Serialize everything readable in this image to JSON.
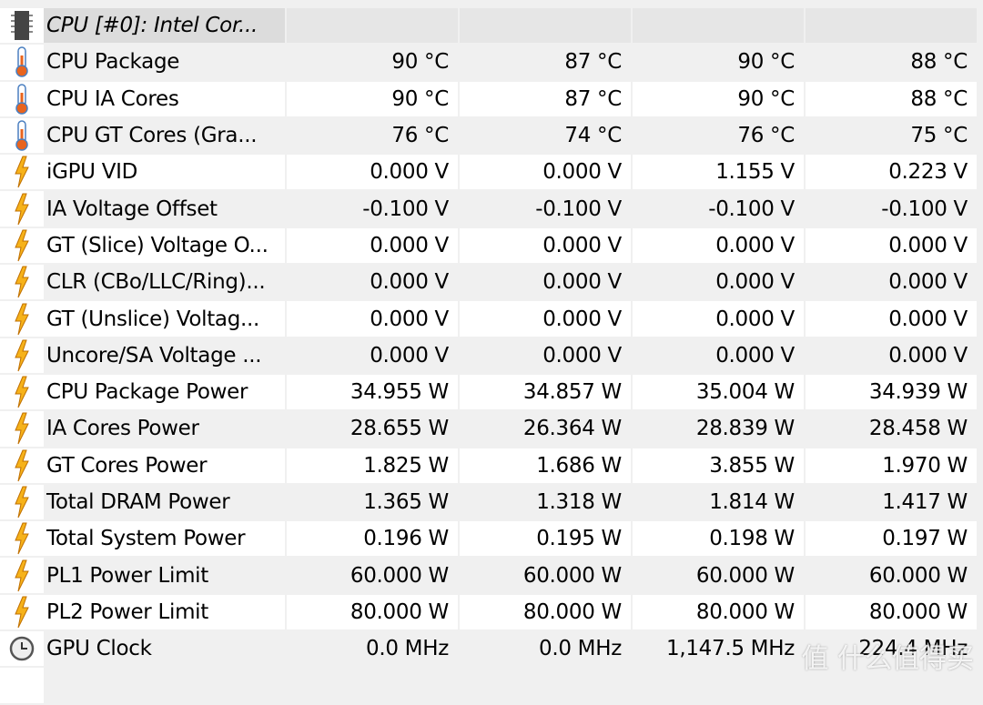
{
  "header": {
    "icon": "chip-icon",
    "label": "CPU [#0]: Intel Cor..."
  },
  "rows": [
    {
      "icon": "thermometer",
      "label": "CPU Package",
      "values": [
        "90 °C",
        "87 °C",
        "90 °C",
        "88 °C"
      ]
    },
    {
      "icon": "thermometer",
      "label": "CPU IA Cores",
      "values": [
        "90 °C",
        "87 °C",
        "90 °C",
        "88 °C"
      ]
    },
    {
      "icon": "thermometer",
      "label": "CPU GT Cores (Gra...",
      "values": [
        "76 °C",
        "74 °C",
        "76 °C",
        "75 °C"
      ]
    },
    {
      "icon": "lightning",
      "label": "iGPU VID",
      "values": [
        "0.000 V",
        "0.000 V",
        "1.155 V",
        "0.223 V"
      ]
    },
    {
      "icon": "lightning",
      "label": "IA Voltage Offset",
      "values": [
        "-0.100 V",
        "-0.100 V",
        "-0.100 V",
        "-0.100 V"
      ]
    },
    {
      "icon": "lightning",
      "label": "GT (Slice) Voltage O...",
      "values": [
        "0.000 V",
        "0.000 V",
        "0.000 V",
        "0.000 V"
      ]
    },
    {
      "icon": "lightning",
      "label": "CLR (CBo/LLC/Ring)...",
      "values": [
        "0.000 V",
        "0.000 V",
        "0.000 V",
        "0.000 V"
      ]
    },
    {
      "icon": "lightning",
      "label": "GT (Unslice) Voltag...",
      "values": [
        "0.000 V",
        "0.000 V",
        "0.000 V",
        "0.000 V"
      ]
    },
    {
      "icon": "lightning",
      "label": "Uncore/SA Voltage ...",
      "values": [
        "0.000 V",
        "0.000 V",
        "0.000 V",
        "0.000 V"
      ]
    },
    {
      "icon": "lightning",
      "label": "CPU Package Power",
      "values": [
        "34.955 W",
        "34.857 W",
        "35.004 W",
        "34.939 W"
      ]
    },
    {
      "icon": "lightning",
      "label": "IA Cores Power",
      "values": [
        "28.655 W",
        "26.364 W",
        "28.839 W",
        "28.458 W"
      ]
    },
    {
      "icon": "lightning",
      "label": "GT Cores Power",
      "values": [
        "1.825 W",
        "1.686 W",
        "3.855 W",
        "1.970 W"
      ]
    },
    {
      "icon": "lightning",
      "label": "Total DRAM Power",
      "values": [
        "1.365 W",
        "1.318 W",
        "1.814 W",
        "1.417 W"
      ]
    },
    {
      "icon": "lightning",
      "label": "Total System Power",
      "values": [
        "0.196 W",
        "0.195 W",
        "0.198 W",
        "0.197 W"
      ]
    },
    {
      "icon": "lightning",
      "label": "PL1 Power Limit",
      "values": [
        "60.000 W",
        "60.000 W",
        "60.000 W",
        "60.000 W"
      ]
    },
    {
      "icon": "lightning",
      "label": "PL2 Power Limit",
      "values": [
        "80.000 W",
        "80.000 W",
        "80.000 W",
        "80.000 W"
      ]
    },
    {
      "icon": "clock",
      "label": "GPU Clock",
      "values": [
        "0.0 MHz",
        "0.0 MHz",
        "1,147.5 MHz",
        "224.4 MHz"
      ]
    }
  ],
  "watermark": "值 什么值得买"
}
